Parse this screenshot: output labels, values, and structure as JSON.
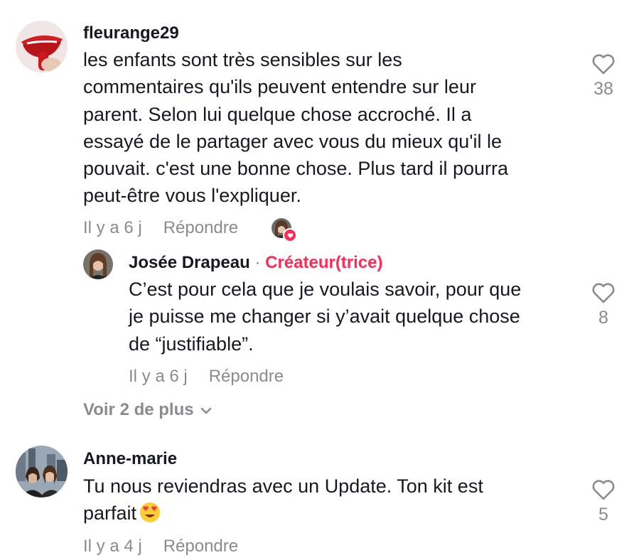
{
  "comments": [
    {
      "username": "fleurange29",
      "lines": [
        "les enfants sont très sensibles sur les",
        "commentaires qu'ils peuvent entendre sur leur",
        "parent. Selon lui quelque chose accroché. Il a",
        "essayé de le partager avec vous du mieux qu'il le",
        "pouvait. c'est une bonne chose. Plus tard il pourra",
        "peut-être vous l'expliquer."
      ],
      "time": "Il y a 6 j",
      "reply_label": "Répondre",
      "likes": "38"
    },
    {
      "username": "Josée Drapeau",
      "separator": "·",
      "creator_badge": "Créateur(trice)",
      "lines": [
        "C’est pour cela que je voulais savoir, pour que",
        "je puisse me changer si y’avait quelque chose",
        "de “justifiable”."
      ],
      "time": "Il y a 6 j",
      "reply_label": "Répondre",
      "likes": "8"
    },
    {
      "username": "Anne-marie",
      "lines": [
        "Tu nous reviendras avec un Update. Ton kit est",
        "parfait"
      ],
      "emoji": "heart-eyes-emoji",
      "time": "Il y a 4 j",
      "reply_label": "Répondre",
      "likes": "5"
    }
  ],
  "view_more": "Voir 2 de plus",
  "colors": {
    "text": "#161823",
    "muted": "#8a8b91",
    "accent": "#fe2c55"
  }
}
